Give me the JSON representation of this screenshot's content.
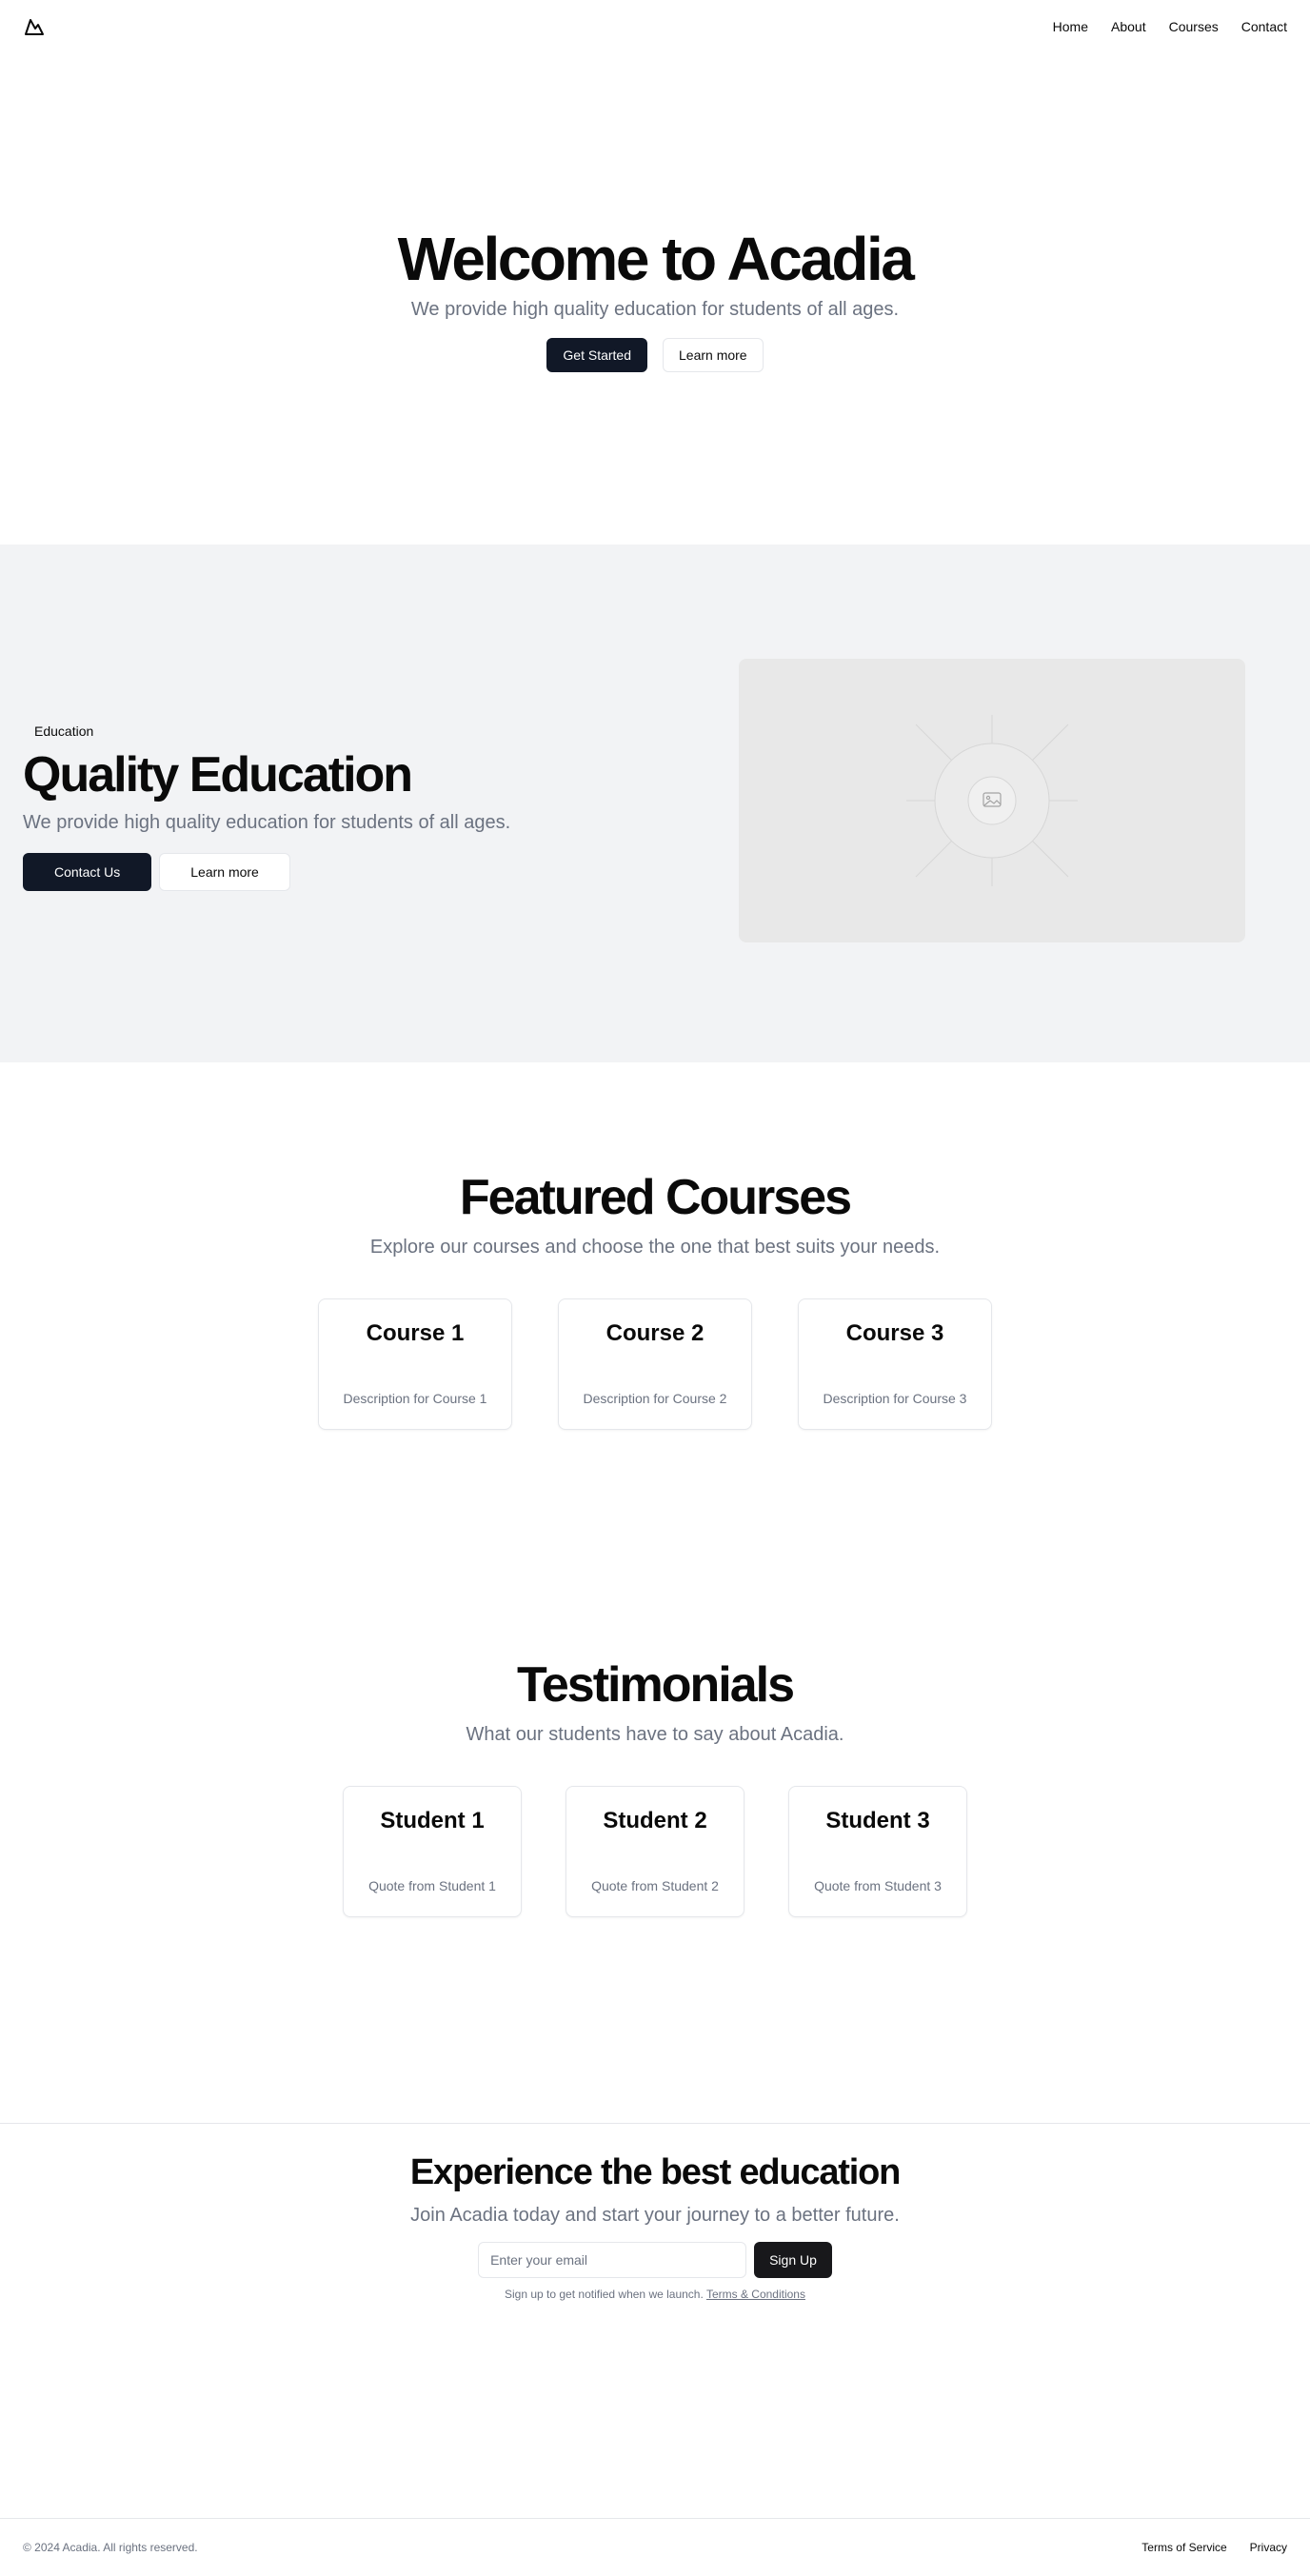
{
  "nav": {
    "logo_icon": "mountain-icon",
    "links": [
      "Home",
      "About",
      "Courses",
      "Contact"
    ]
  },
  "hero": {
    "title": "Welcome to Acadia",
    "subtitle": "We provide high quality education for students of all ages.",
    "primary_button": "Get Started",
    "secondary_button": "Learn more"
  },
  "feature": {
    "badge": "Education",
    "title": "Quality Education",
    "subtitle": "We provide high quality education for students of all ages.",
    "primary_button": "Contact Us",
    "secondary_button": "Learn more",
    "image_icon": "image-placeholder-icon"
  },
  "courses": {
    "title": "Featured Courses",
    "subtitle": "Explore our courses and choose the one that best suits your needs.",
    "items": [
      {
        "title": "Course 1",
        "description": "Description for Course 1"
      },
      {
        "title": "Course 2",
        "description": "Description for Course 2"
      },
      {
        "title": "Course 3",
        "description": "Description for Course 3"
      }
    ]
  },
  "testimonials": {
    "title": "Testimonials",
    "subtitle": "What our students have to say about Acadia.",
    "items": [
      {
        "name": "Student 1",
        "quote": "Quote from Student 1"
      },
      {
        "name": "Student 2",
        "quote": "Quote from Student 2"
      },
      {
        "name": "Student 3",
        "quote": "Quote from Student 3"
      }
    ]
  },
  "cta": {
    "title": "Experience the best education",
    "subtitle": "Join Acadia today and start your journey to a better future.",
    "email_placeholder": "Enter your email",
    "button": "Sign Up",
    "note": "Sign up to get notified when we launch.",
    "terms_link": "Terms & Conditions"
  },
  "footer": {
    "copyright": "© 2024 Acadia. All rights reserved.",
    "links": [
      "Terms of Service",
      "Privacy"
    ]
  },
  "colors": {
    "primary": "#111827",
    "muted_text": "#6b7280",
    "section_bg": "#f2f3f5",
    "border": "#e5e7eb"
  }
}
